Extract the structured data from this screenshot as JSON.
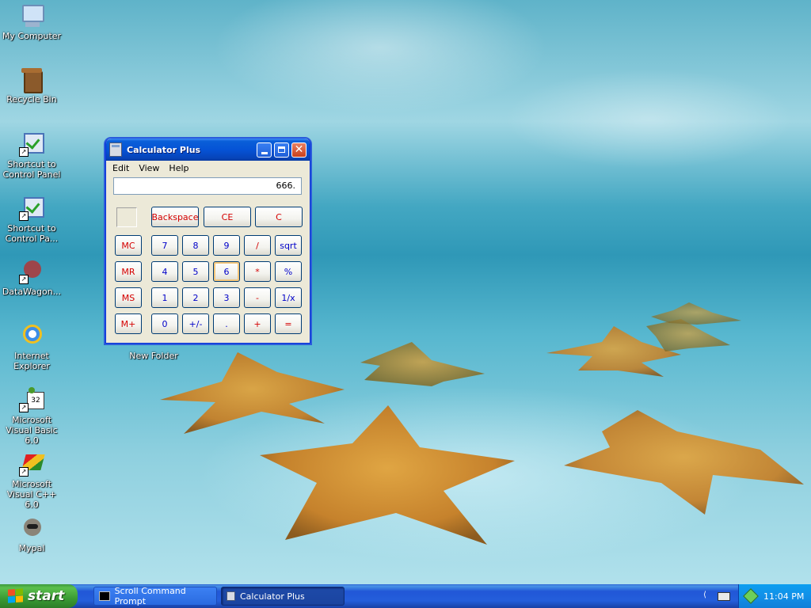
{
  "desktop": {
    "icons": [
      {
        "label": "My Computer",
        "icon": "computer-icon"
      },
      {
        "label": "Recycle Bin",
        "icon": "recycle-bin-icon"
      },
      {
        "label": "Shortcut to Control Panel",
        "icon": "control-panel-icon"
      },
      {
        "label": "Shortcut to Control Pa...",
        "icon": "control-panel-icon"
      },
      {
        "label": "DataWagon...",
        "icon": "datawagon-icon"
      },
      {
        "label": "Internet Explorer",
        "icon": "internet-explorer-icon"
      },
      {
        "label": "Microsoft Visual Basic 6.0",
        "icon": "visual-basic-icon"
      },
      {
        "label": "Microsoft Visual C++ 6.0",
        "icon": "visual-cpp-icon"
      },
      {
        "label": "Mypal",
        "icon": "mypal-icon"
      },
      {
        "label": "New Folder",
        "icon": "folder-icon"
      }
    ]
  },
  "calculator": {
    "title": "Calculator Plus",
    "menu": [
      "Edit",
      "View",
      "Help"
    ],
    "display": "666.",
    "top_buttons": [
      "Backspace",
      "CE",
      "C"
    ],
    "memory_buttons": [
      "MC",
      "MR",
      "MS",
      "M+"
    ],
    "keypad": [
      [
        "7",
        "8",
        "9",
        "/",
        "sqrt"
      ],
      [
        "4",
        "5",
        "6",
        "*",
        "%"
      ],
      [
        "1",
        "2",
        "3",
        "-",
        "1/x"
      ],
      [
        "0",
        "+/-",
        ".",
        "+",
        "="
      ]
    ]
  },
  "taskbar": {
    "start_label": "start",
    "tasks": [
      {
        "label": "Scroll Command Prompt",
        "icon": "command-prompt-icon",
        "active": false
      },
      {
        "label": "Calculator Plus",
        "icon": "calculator-icon",
        "active": true
      }
    ],
    "clock": "11:04 PM"
  },
  "colors": {
    "xp_blue": "#245edb",
    "start_green": "#3a9b34",
    "calc_red_text": "#d40000",
    "calc_blue_text": "#0000c8"
  }
}
